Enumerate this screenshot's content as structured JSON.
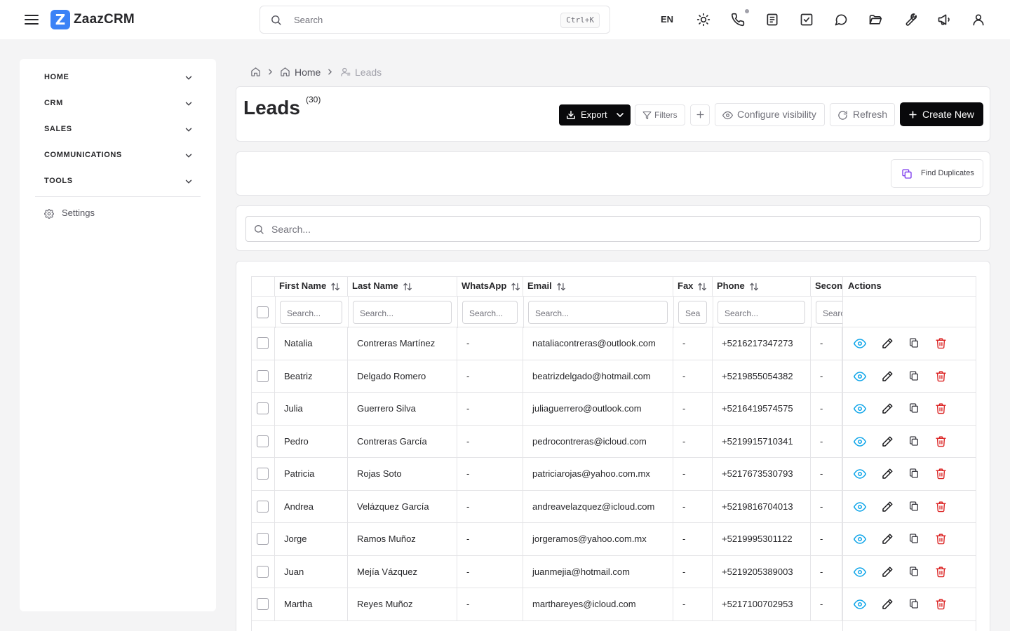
{
  "app": {
    "brand": "ZaazCRM",
    "logo_letter": "Z",
    "search_placeholder": "Search",
    "search_shortcut": "Ctrl+K",
    "language": "EN"
  },
  "sidebar": {
    "items": [
      {
        "label": "HOME"
      },
      {
        "label": "CRM"
      },
      {
        "label": "SALES"
      },
      {
        "label": "COMMUNICATIONS"
      },
      {
        "label": "TOOLS"
      }
    ],
    "settings_label": "Settings"
  },
  "breadcrumb": {
    "home": "Home",
    "current": "Leads"
  },
  "header": {
    "title": "Leads",
    "count": "(30)",
    "export_label": "Export",
    "filters_label": "Filters",
    "configure_label": "Configure visibility",
    "refresh_label": "Refresh",
    "create_label": "Create New"
  },
  "toolbar": {
    "find_duplicates_label": "Find Duplicates"
  },
  "search": {
    "placeholder": "Search..."
  },
  "table": {
    "columns": [
      "First Name",
      "Last Name",
      "WhatsApp",
      "Email",
      "Fax",
      "Phone",
      "Secon",
      "Actions"
    ],
    "filter_placeholder": "Search...",
    "filter_placeholder_fax": "Sea",
    "filter_placeholder_second": "Searc",
    "rows": [
      {
        "first": "Natalia",
        "last": "Contreras Martínez",
        "whatsapp": "-",
        "email": "nataliacontreras@outlook.com",
        "fax": "-",
        "phone": "+5216217347273",
        "second": "-"
      },
      {
        "first": "Beatriz",
        "last": "Delgado Romero",
        "whatsapp": "-",
        "email": "beatrizdelgado@hotmail.com",
        "fax": "-",
        "phone": "+5219855054382",
        "second": "-"
      },
      {
        "first": "Julia",
        "last": "Guerrero Silva",
        "whatsapp": "-",
        "email": "juliaguerrero@outlook.com",
        "fax": "-",
        "phone": "+5216419574575",
        "second": "-"
      },
      {
        "first": "Pedro",
        "last": "Contreras García",
        "whatsapp": "-",
        "email": "pedrocontreras@icloud.com",
        "fax": "-",
        "phone": "+5219915710341",
        "second": "-"
      },
      {
        "first": "Patricia",
        "last": "Rojas Soto",
        "whatsapp": "-",
        "email": "patriciarojas@yahoo.com.mx",
        "fax": "-",
        "phone": "+5217673530793",
        "second": "-"
      },
      {
        "first": "Andrea",
        "last": "Velázquez García",
        "whatsapp": "-",
        "email": "andreavelazquez@icloud.com",
        "fax": "-",
        "phone": "+5219816704013",
        "second": "-"
      },
      {
        "first": "Jorge",
        "last": "Ramos Muñoz",
        "whatsapp": "-",
        "email": "jorgeramos@yahoo.com.mx",
        "fax": "-",
        "phone": "+5219995301122",
        "second": "-"
      },
      {
        "first": "Juan",
        "last": "Mejía Vázquez",
        "whatsapp": "-",
        "email": "juanmejia@hotmail.com",
        "fax": "-",
        "phone": "+5219205389003",
        "second": "-"
      },
      {
        "first": "Martha",
        "last": "Reyes Muñoz",
        "whatsapp": "-",
        "email": "marthareyes@icloud.com",
        "fax": "-",
        "phone": "+5217100702953",
        "second": "-"
      }
    ]
  },
  "colors": {
    "brand": "#3b82f6",
    "view": "#0ea5e9",
    "delete": "#dc2626",
    "duplicate_icon": "#7c3aed"
  }
}
